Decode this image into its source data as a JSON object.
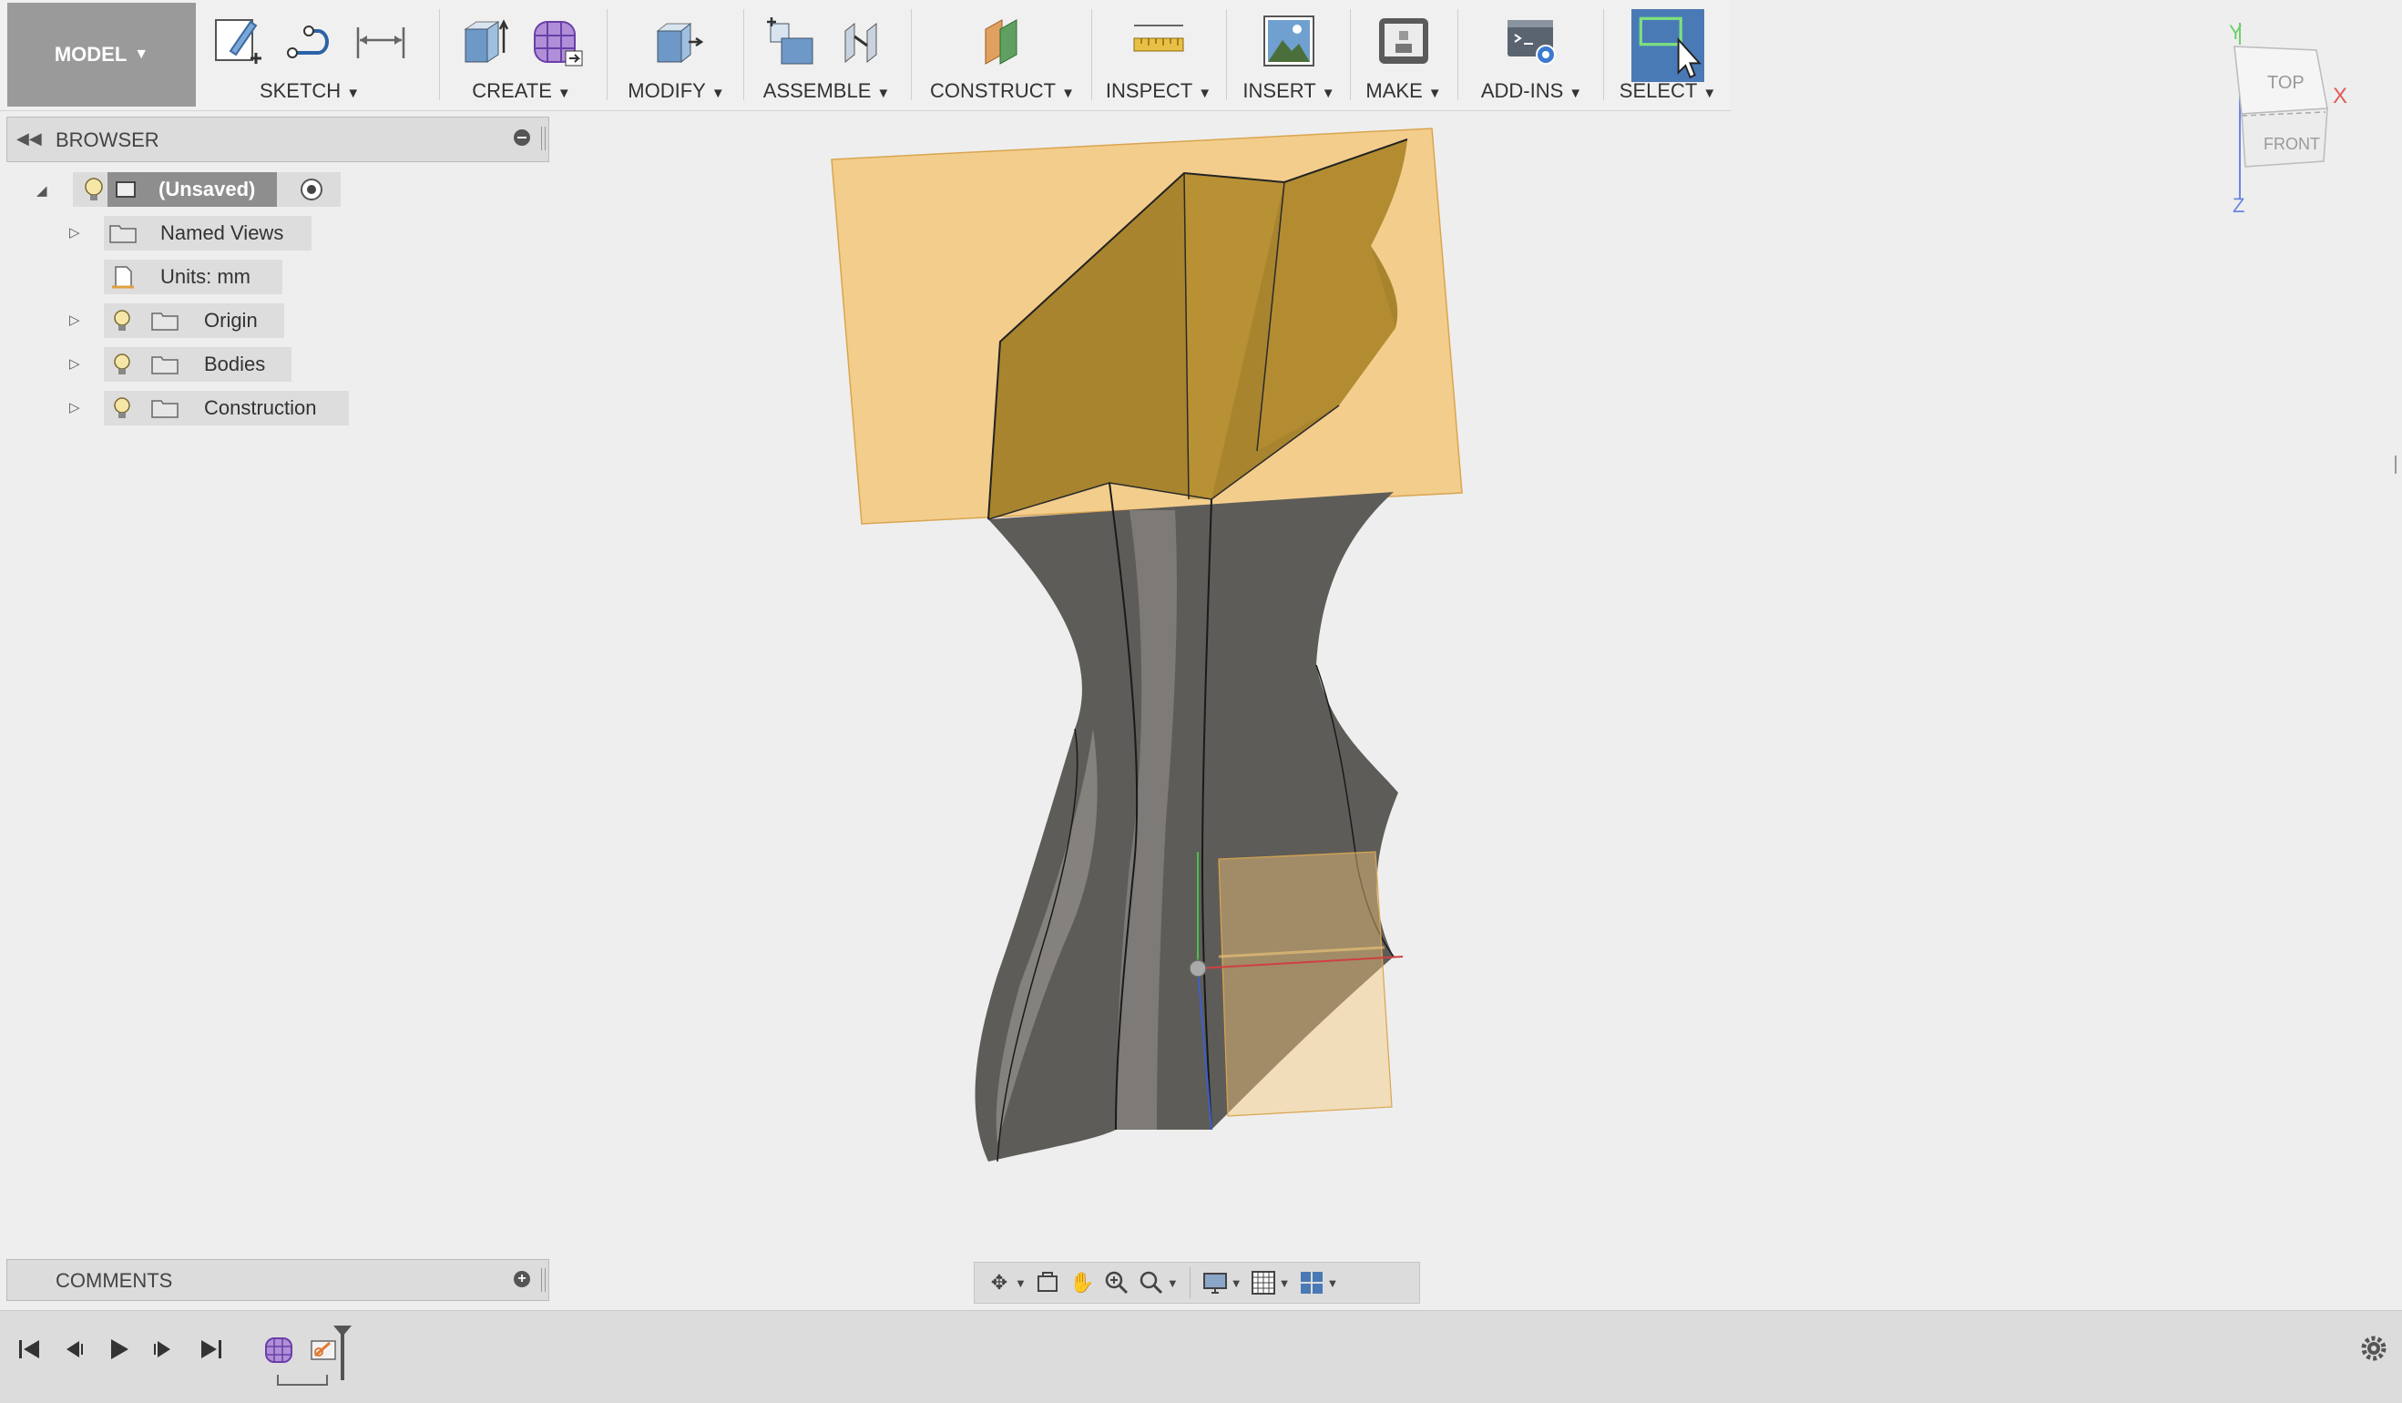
{
  "toolbar": {
    "workspace_label": "MODEL",
    "groups": [
      {
        "label": "SKETCH"
      },
      {
        "label": "CREATE"
      },
      {
        "label": "MODIFY"
      },
      {
        "label": "ASSEMBLE"
      },
      {
        "label": "CONSTRUCT"
      },
      {
        "label": "INSPECT"
      },
      {
        "label": "INSERT"
      },
      {
        "label": "MAKE"
      },
      {
        "label": "ADD-INS"
      },
      {
        "label": "SELECT"
      }
    ],
    "select_accent": "#4a7ab5"
  },
  "browser": {
    "title": "BROWSER",
    "root": {
      "label": "(Unsaved)"
    },
    "items": [
      {
        "label": "Named Views",
        "icon": "folder-icon"
      },
      {
        "label": "Units: mm",
        "icon": "document-icon"
      },
      {
        "label": "Origin",
        "icon": "folder-icon"
      },
      {
        "label": "Bodies",
        "icon": "folder-icon"
      },
      {
        "label": "Construction",
        "icon": "folder-icon"
      }
    ]
  },
  "comments": {
    "title": "COMMENTS"
  },
  "viewcube": {
    "top_label": "TOP",
    "front_label": "FRONT",
    "axis_x": "X",
    "axis_y": "Y",
    "axis_z": "Z"
  },
  "colors": {
    "plane": "#f3c77a",
    "body": "#5e5c58",
    "body_inner": "#a8842e"
  }
}
